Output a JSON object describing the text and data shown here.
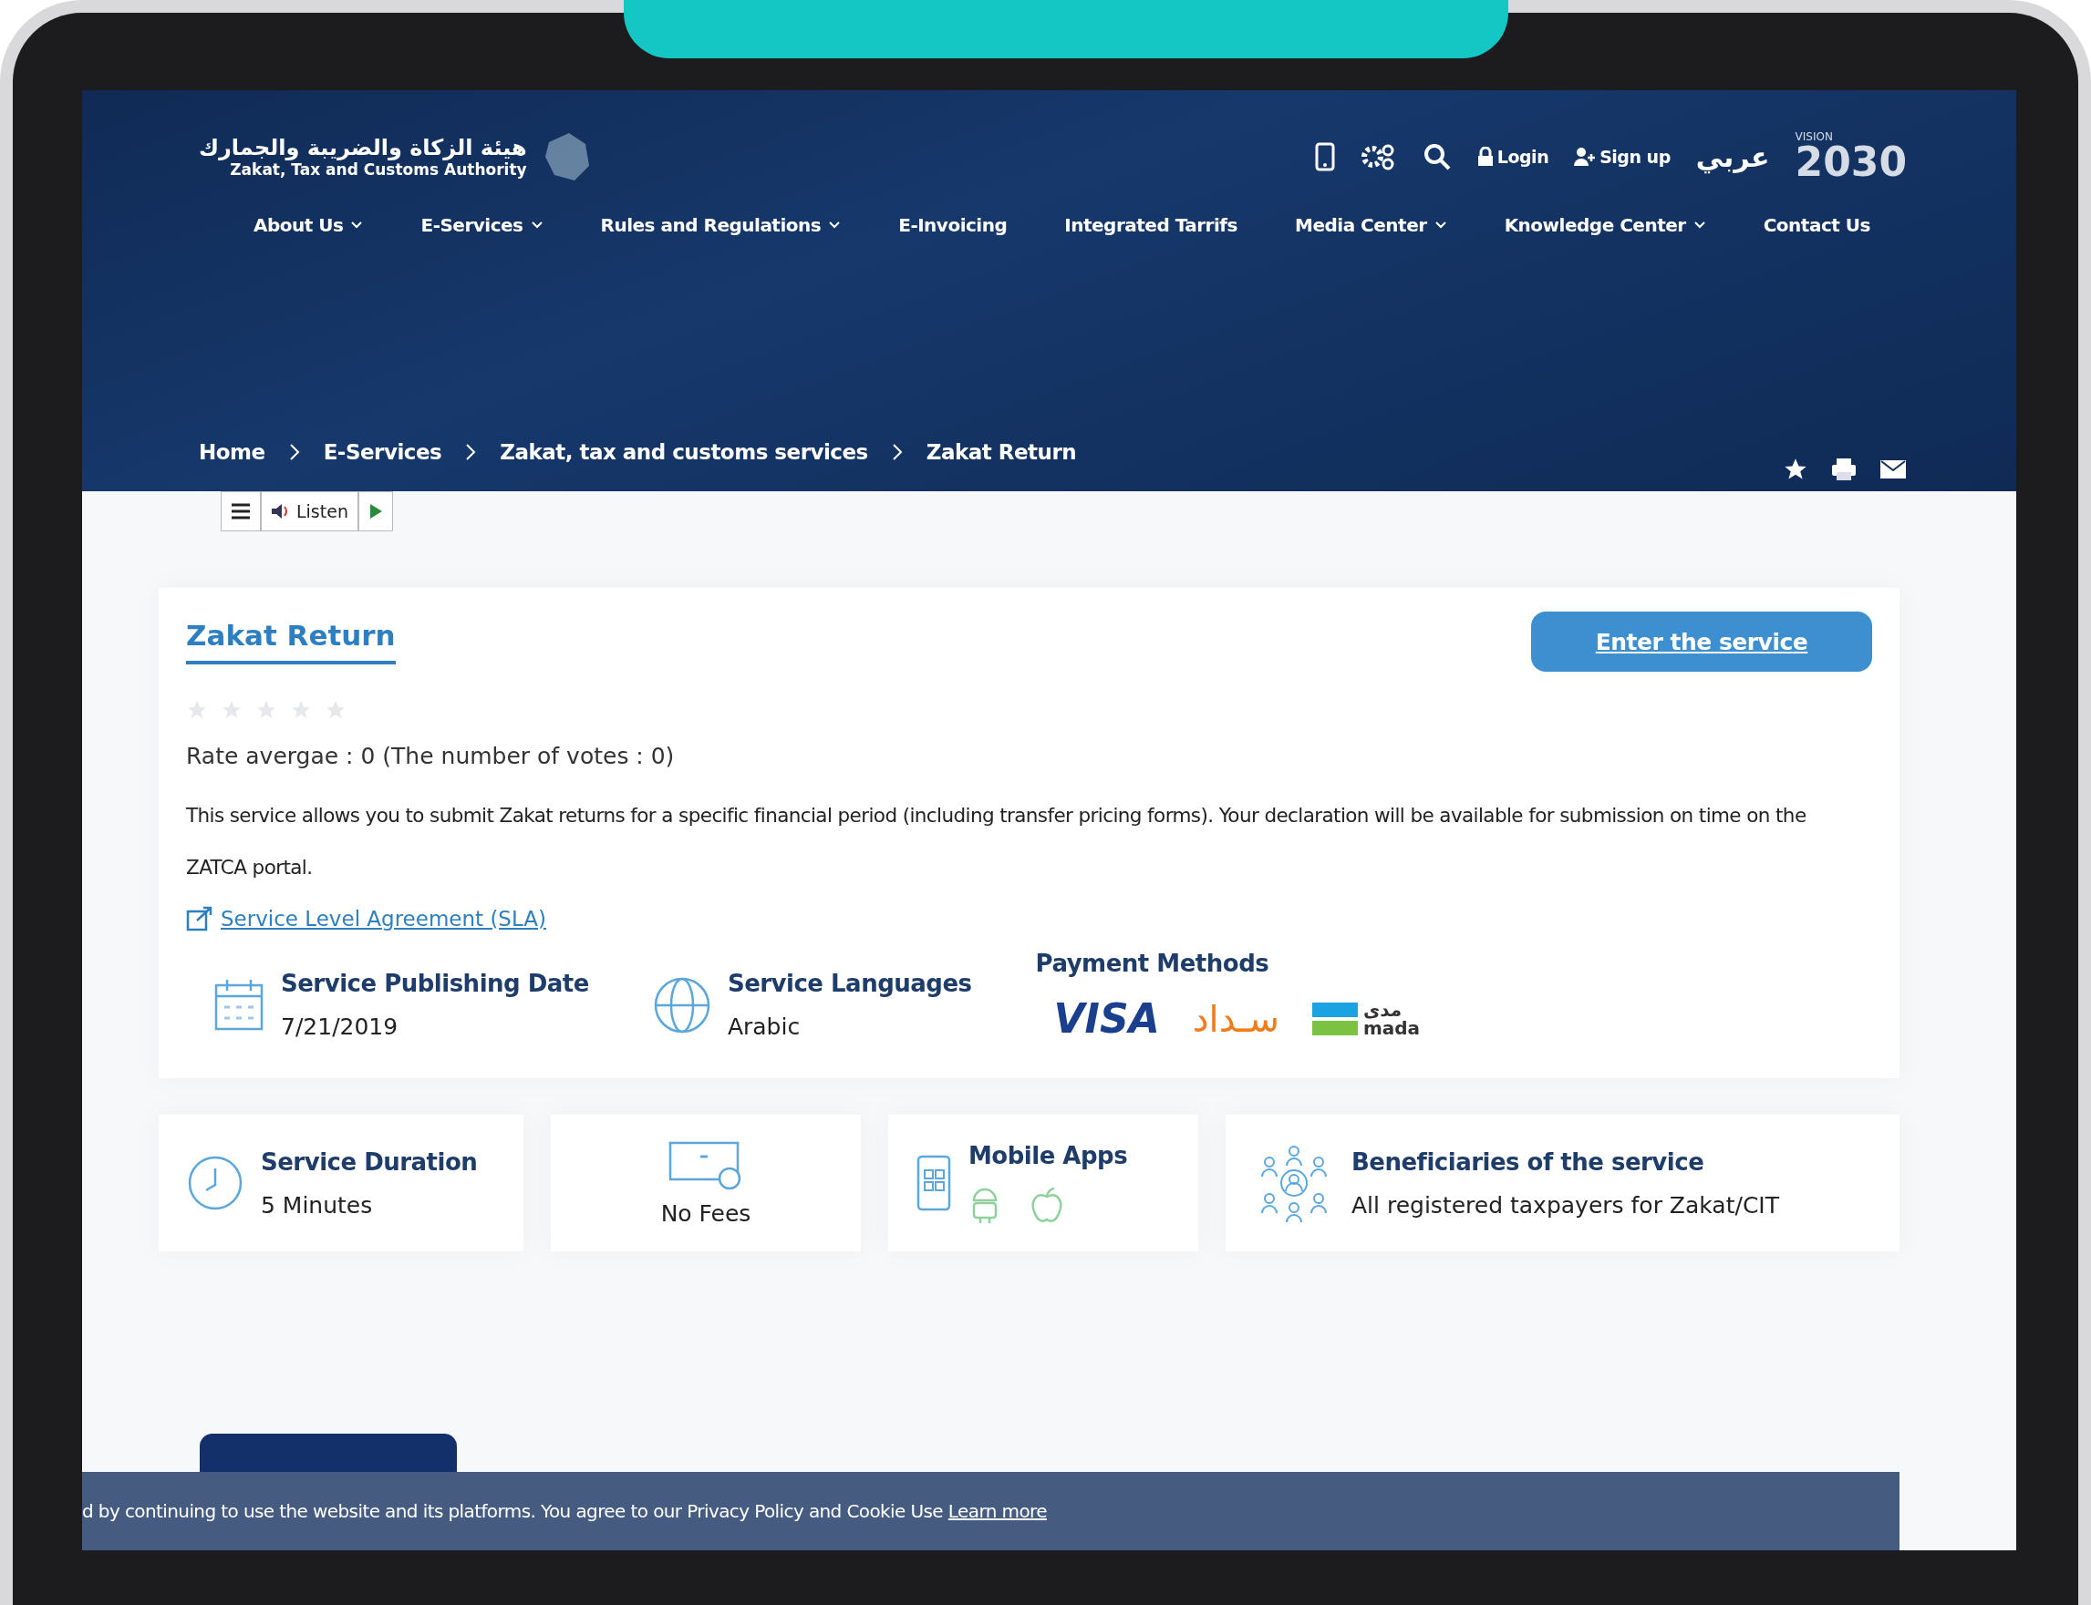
{
  "header": {
    "logo_arabic": "هيئة الزكاة والضريبة والجمارك",
    "logo_english": "Zakat, Tax and Customs Authority",
    "login": "Login",
    "signup": "Sign up",
    "language": "عربي",
    "vision_label": "VISION",
    "vision_year": "2030"
  },
  "nav": [
    {
      "label": "About Us",
      "dropdown": true
    },
    {
      "label": "E-Services",
      "dropdown": true
    },
    {
      "label": "Rules and Regulations",
      "dropdown": true
    },
    {
      "label": "E-Invoicing",
      "dropdown": false
    },
    {
      "label": "Integrated Tarrifs",
      "dropdown": false
    },
    {
      "label": "Media Center",
      "dropdown": true
    },
    {
      "label": "Knowledge Center",
      "dropdown": true
    },
    {
      "label": "Contact Us",
      "dropdown": false
    }
  ],
  "breadcrumb": [
    "Home",
    "E-Services",
    "Zakat, tax and customs services",
    "Zakat Return"
  ],
  "listen_toolbar": {
    "label": "Listen"
  },
  "service": {
    "title": "Zakat Return",
    "button": "Enter the service",
    "stars": 0,
    "rating": "Rate avergae : 0 (The number of votes : 0)",
    "description": "This service allows you to submit Zakat returns for a specific financial period (including transfer pricing forms). Your declaration will be available for submission on time on the ZATCA portal.",
    "sla_link": "Service Level Agreement (SLA)",
    "info": [
      {
        "kind": "date",
        "label": "Service Publishing Date",
        "value": "7/21/2019"
      },
      {
        "kind": "language",
        "label": "Service Languages",
        "value": "Arabic"
      }
    ],
    "payment": {
      "title": "Payment Methods",
      "visa": "VISA",
      "sadad": "سـداد",
      "mada_arabic": "مدى",
      "mada": "mada"
    }
  },
  "cards": [
    {
      "kind": "duration",
      "label": "Service Duration",
      "value": "5 Minutes"
    },
    {
      "kind": "fees",
      "value": "No Fees"
    },
    {
      "kind": "apps",
      "label": "Mobile Apps"
    },
    {
      "kind": "beneficiaries",
      "label": "Beneficiaries of the service",
      "value": "All registered taxpayers for Zakat/CIT"
    }
  ],
  "cookie": {
    "text": "d by continuing to use the website and its platforms. You agree to our Privacy Policy and Cookie Use",
    "link": "Learn more"
  }
}
